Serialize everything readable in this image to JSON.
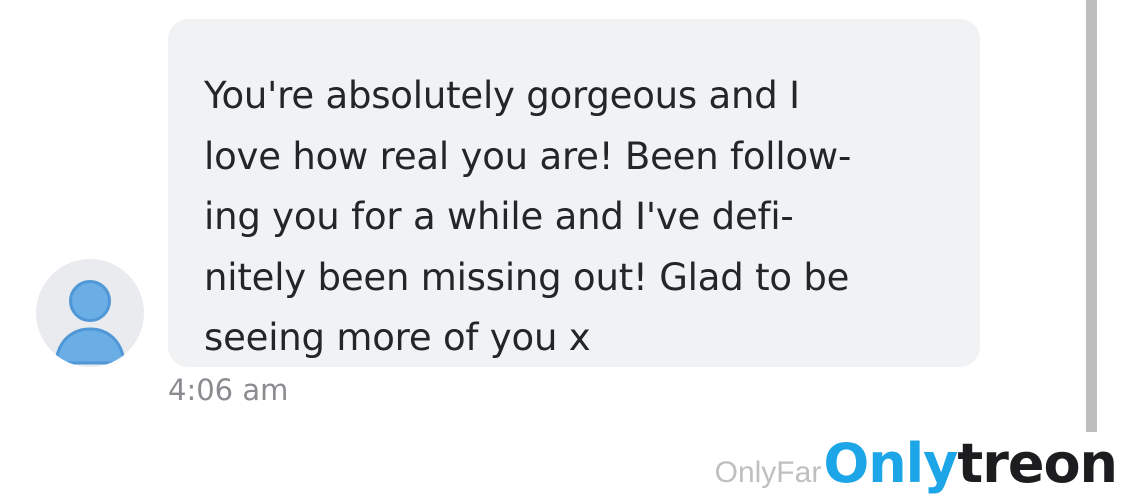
{
  "message": {
    "lines": [
      "You're absolutely gorgeous and I",
      "love how real you are! Been follow-",
      "ing you for a while and I've defi-",
      "nitely been missing out! Glad to be",
      "seeing more of you x"
    ],
    "timestamp": "4:06 am"
  },
  "avatar": {
    "icon": "user-icon",
    "color": "#6aaee5"
  },
  "watermark": {
    "prefix": "OnlyFar",
    "brand_accent": "Only",
    "brand_rest": "treon",
    "accent_color": "#1ca6e8"
  },
  "colors": {
    "bubble": "#f0f2f4",
    "text": "#242529",
    "timestamp": "#8a8c90"
  }
}
